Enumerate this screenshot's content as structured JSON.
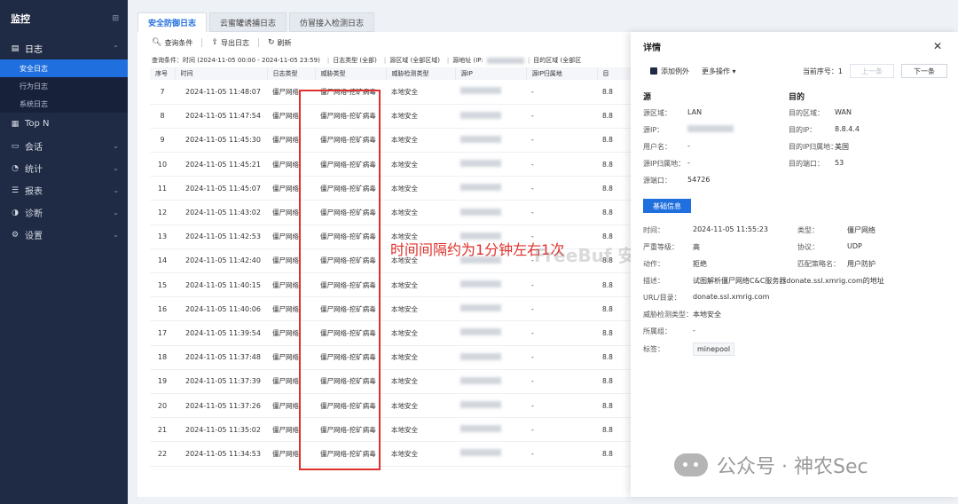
{
  "sidebar": {
    "title": "监控",
    "items": [
      {
        "label": "日志",
        "expanded": true
      },
      {
        "label": "Top N"
      },
      {
        "label": "会话"
      },
      {
        "label": "统计"
      },
      {
        "label": "报表"
      },
      {
        "label": "诊断"
      },
      {
        "label": "设置"
      }
    ],
    "sub_items": [
      "安全日志",
      "行为日志",
      "系统日志"
    ]
  },
  "tabs": [
    "安全防御日志",
    "云蜜罐诱捕日志",
    "仿冒接入检测日志"
  ],
  "toolbar": {
    "query": "查询条件",
    "export": "导出日志",
    "refresh": "刷新"
  },
  "query": {
    "condition": "查询条件：时间  (2024-11-05 00:00 - 2024-11-05 23:59)",
    "log_type": "日志类型  (全部)",
    "src_zone": "源区域  (全部区域)",
    "src_addr": "源地址  (IP:",
    "dst_zone": "目的区域  (全部区"
  },
  "table": {
    "headers": [
      "序号",
      "时间",
      "日志类型",
      "威胁类型",
      "威胁检测类型",
      "源IP",
      "源IP归属地",
      "目"
    ],
    "rows": [
      {
        "seq": "7",
        "time": "2024-11-05 11:48:07",
        "log_type": "僵尸网络",
        "threat": "僵尸网络-挖矿病毒",
        "detect": "本地安全",
        "src_geo": "-",
        "dst": "8.8"
      },
      {
        "seq": "8",
        "time": "2024-11-05 11:47:54",
        "log_type": "僵尸网络",
        "threat": "僵尸网络-挖矿病毒",
        "detect": "本地安全",
        "src_geo": "-",
        "dst": "8.8"
      },
      {
        "seq": "9",
        "time": "2024-11-05 11:45:30",
        "log_type": "僵尸网络",
        "threat": "僵尸网络-挖矿病毒",
        "detect": "本地安全",
        "src_geo": "-",
        "dst": "8.8"
      },
      {
        "seq": "10",
        "time": "2024-11-05 11:45:21",
        "log_type": "僵尸网络",
        "threat": "僵尸网络-挖矿病毒",
        "detect": "本地安全",
        "src_geo": "-",
        "dst": "8.8"
      },
      {
        "seq": "11",
        "time": "2024-11-05 11:45:07",
        "log_type": "僵尸网络",
        "threat": "僵尸网络-挖矿病毒",
        "detect": "本地安全",
        "src_geo": "-",
        "dst": "8.8"
      },
      {
        "seq": "12",
        "time": "2024-11-05 11:43:02",
        "log_type": "僵尸网络",
        "threat": "僵尸网络-挖矿病毒",
        "detect": "本地安全",
        "src_geo": "-",
        "dst": "8.8"
      },
      {
        "seq": "13",
        "time": "2024-11-05 11:42:53",
        "log_type": "僵尸网络",
        "threat": "僵尸网络-挖矿病毒",
        "detect": "本地安全",
        "src_geo": "-",
        "dst": "8.8"
      },
      {
        "seq": "14",
        "time": "2024-11-05 11:42:40",
        "log_type": "僵尸网络",
        "threat": "僵尸网络-挖矿病毒",
        "detect": "本地安全",
        "src_geo": "-",
        "dst": "8.8"
      },
      {
        "seq": "15",
        "time": "2024-11-05 11:40:15",
        "log_type": "僵尸网络",
        "threat": "僵尸网络-挖矿病毒",
        "detect": "本地安全",
        "src_geo": "-",
        "dst": "8.8"
      },
      {
        "seq": "16",
        "time": "2024-11-05 11:40:06",
        "log_type": "僵尸网络",
        "threat": "僵尸网络-挖矿病毒",
        "detect": "本地安全",
        "src_geo": "-",
        "dst": "8.8"
      },
      {
        "seq": "17",
        "time": "2024-11-05 11:39:54",
        "log_type": "僵尸网络",
        "threat": "僵尸网络-挖矿病毒",
        "detect": "本地安全",
        "src_geo": "-",
        "dst": "8.8"
      },
      {
        "seq": "18",
        "time": "2024-11-05 11:37:48",
        "log_type": "僵尸网络",
        "threat": "僵尸网络-挖矿病毒",
        "detect": "本地安全",
        "src_geo": "-",
        "dst": "8.8"
      },
      {
        "seq": "19",
        "time": "2024-11-05 11:37:39",
        "log_type": "僵尸网络",
        "threat": "僵尸网络-挖矿病毒",
        "detect": "本地安全",
        "src_geo": "-",
        "dst": "8.8"
      },
      {
        "seq": "20",
        "time": "2024-11-05 11:37:26",
        "log_type": "僵尸网络",
        "threat": "僵尸网络-挖矿病毒",
        "detect": "本地安全",
        "src_geo": "-",
        "dst": "8.8"
      },
      {
        "seq": "21",
        "time": "2024-11-05 11:35:02",
        "log_type": "僵尸网络",
        "threat": "僵尸网络-挖矿病毒",
        "detect": "本地安全",
        "src_geo": "-",
        "dst": "8.8"
      },
      {
        "seq": "22",
        "time": "2024-11-05 11:34:53",
        "log_type": "僵尸网络",
        "threat": "僵尸网络-挖矿病毒",
        "detect": "本地安全",
        "src_geo": "-",
        "dst": "8.8"
      }
    ]
  },
  "annotation": "时间间隔约为1分钟左右1次",
  "watermark_center": "FreeBuf 安信攻防社区",
  "watermark_corner": "公众号 · 神农Sec",
  "detail": {
    "title": "详情",
    "add_exception": "添加例外",
    "more_ops": "更多操作",
    "current_seq": "当前序号：1",
    "prev": "上一条",
    "next": "下一条",
    "src_header": "源",
    "dst_header": "目的",
    "src": [
      {
        "k": "源区域：",
        "v": "LAN"
      },
      {
        "k": "源IP：",
        "v": ""
      },
      {
        "k": "用户名：",
        "v": "-"
      },
      {
        "k": "源IP归属地：",
        "v": "-"
      },
      {
        "k": "源端口：",
        "v": "54726"
      }
    ],
    "dst": [
      {
        "k": "目的区域：",
        "v": "WAN"
      },
      {
        "k": "目的IP：",
        "v": "8.8.4.4"
      },
      {
        "k": "目的IP归属地：",
        "v": "美国"
      },
      {
        "k": "目的端口：",
        "v": "53"
      }
    ],
    "basic_info": "基础信息",
    "info": {
      "time_k": "时间：",
      "time_v": "2024-11-05 11:55:23",
      "type_k": "类型：",
      "type_v": "僵尸网络",
      "sev_k": "严重等级：",
      "sev_v": "高",
      "proto_k": "协议：",
      "proto_v": "UDP",
      "action_k": "动作：",
      "action_v": "拒绝",
      "policy_k": "匹配策略名：",
      "policy_v": "用户防护",
      "desc_k": "描述：",
      "desc_v": "试图解析僵尸网络C&C服务器donate.ssl.xmrig.com的地址",
      "url_k": "URL/目录：",
      "url_v": "donate.ssl.xmrig.com",
      "detect_k": "威胁检测类型：",
      "detect_v": "本地安全",
      "group_k": "所属组：",
      "group_v": "-",
      "tag_k": "标签：",
      "tag_v": "minepool"
    }
  },
  "colors": {
    "accent": "#1f6fde",
    "sidebar": "#1f2a44",
    "highlight": "#e0302b"
  }
}
